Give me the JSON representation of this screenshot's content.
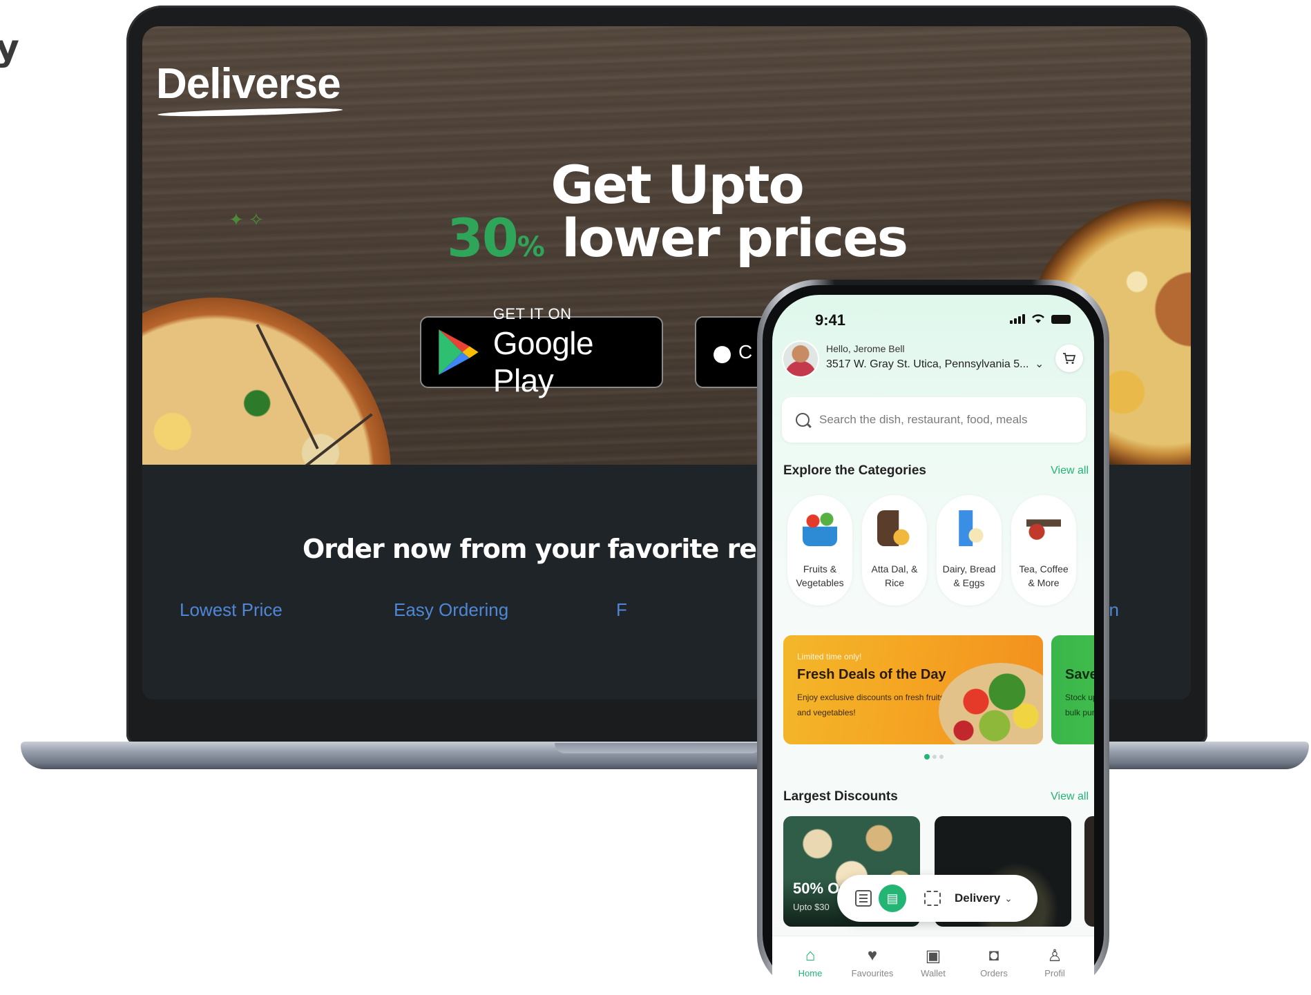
{
  "corner": {
    "text": "y"
  },
  "website": {
    "brand": "Deliverse",
    "headline_line1": "Get Upto",
    "headline_pct": "30",
    "headline_pct_sign": "%",
    "headline_line2_rest": " lower prices",
    "google_play": {
      "small": "GET IT ON",
      "big": "Google Play"
    },
    "app_store": {
      "partial_text": "C"
    },
    "tagline": "Order now from your favorite restau",
    "features": [
      "Lowest Price",
      "Easy Ordering",
      "F",
      "on"
    ],
    "colors": {
      "accent_green": "#2fa55a",
      "feature_link": "#4f87d6",
      "wood": "#4b3f35",
      "footer_dark": "#1f2428"
    }
  },
  "phone": {
    "status": {
      "time": "9:41"
    },
    "header": {
      "greeting": "Hello, Jerome Bell",
      "address": "3517 W. Gray St. Utica, Pennsylvania 5...",
      "cart_icon": "cart-icon"
    },
    "search": {
      "placeholder": "Search the dish, restaurant, food, meals"
    },
    "categories": {
      "title": "Explore the Categories",
      "view_all": "View all",
      "items": [
        {
          "label": "Fruits &\nVegetables",
          "icon": "fruits-vegetables-icon"
        },
        {
          "label": "Atta Dal, &\nRice",
          "icon": "atta-dal-rice-icon"
        },
        {
          "label": "Dairy, Bread\n& Eggs",
          "icon": "dairy-bread-eggs-icon"
        },
        {
          "label": "Tea, Coffee\n& More",
          "icon": "tea-coffee-icon"
        }
      ]
    },
    "deals": [
      {
        "tag": "Limited time only!",
        "title": "Fresh Deals of the Day",
        "description": "Enjoy exclusive discounts on fresh fruits and vegetables!"
      },
      {
        "title": "Save",
        "description": "Stock up\nbulk pur"
      }
    ],
    "carousel": {
      "pages": 3,
      "active": 1
    },
    "discounts": {
      "title": "Largest Discounts",
      "view_all": "View all",
      "items": [
        {
          "percent": "50% O",
          "sub": "Upto $30"
        }
      ]
    },
    "floating_bar": {
      "mode_label": "Delivery"
    },
    "tabs": [
      {
        "label": "Home",
        "icon": "home-icon",
        "active": true
      },
      {
        "label": "Favourites",
        "icon": "heart-icon",
        "active": false
      },
      {
        "label": "Wallet",
        "icon": "wallet-icon",
        "active": false
      },
      {
        "label": "Orders",
        "icon": "bag-icon",
        "active": false
      },
      {
        "label": "Profil",
        "icon": "person-icon",
        "active": false
      }
    ],
    "colors": {
      "accent": "#22b573",
      "deal_orange": "#f5a623",
      "deal_green": "#39b54a"
    }
  }
}
